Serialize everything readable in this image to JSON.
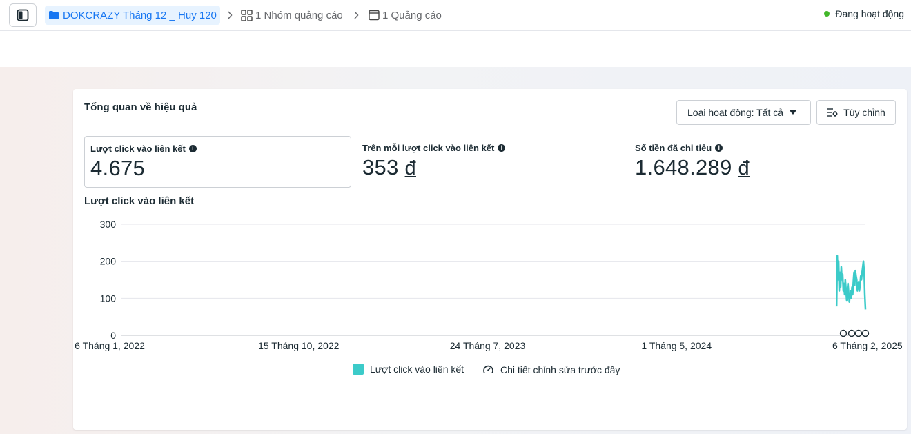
{
  "topbar": {
    "campaign_name": "DOKCRAZY Tháng 12 _ Huy 120",
    "adsets_label": "1 Nhóm quảng cáo",
    "ads_label": "1 Quảng cáo",
    "status_label": "Đang hoạt động",
    "status_color": "#42b72a"
  },
  "card": {
    "title": "Tổng quan về hiệu quả",
    "filter_button": "Loại hoạt động: Tất cả",
    "customize_button": "Tùy chỉnh"
  },
  "metrics": [
    {
      "label": "Lượt click vào liên kết",
      "value": "4.675",
      "currency": ""
    },
    {
      "label": "Trên mỗi lượt click vào liên kết",
      "value": "353",
      "currency": "đ"
    },
    {
      "label": "Số tiền đã chi tiêu",
      "value": "1.648.289",
      "currency": "đ"
    }
  ],
  "chart_data": {
    "type": "line",
    "title": "Lượt click vào liên kết",
    "xlabel": "",
    "ylabel": "",
    "x_tick_labels": [
      "6 Tháng 1, 2022",
      "15 Tháng 10, 2022",
      "24 Tháng 7, 2023",
      "1 Tháng 5, 2024",
      "6 Tháng 2, 2025"
    ],
    "y_ticks": [
      0,
      100,
      200,
      300
    ],
    "ylim": [
      0,
      300
    ],
    "xlim": [
      "2022-01-06",
      "2025-02-06"
    ],
    "grid": true,
    "legend_position": "bottom",
    "series": [
      {
        "name": "Lượt click vào liên kết",
        "color": "#3ccbc9",
        "x": [
          "2024-12-25",
          "2024-12-26",
          "2024-12-27",
          "2024-12-28",
          "2024-12-29",
          "2024-12-30",
          "2024-12-31",
          "2025-01-01",
          "2025-01-02",
          "2025-01-03",
          "2025-01-04",
          "2025-01-05",
          "2025-01-06",
          "2025-01-07",
          "2025-01-08",
          "2025-01-09",
          "2025-01-10",
          "2025-01-11",
          "2025-01-12",
          "2025-01-13",
          "2025-01-14",
          "2025-01-15",
          "2025-01-16",
          "2025-01-17",
          "2025-01-18",
          "2025-01-19",
          "2025-01-20",
          "2025-01-21",
          "2025-01-22",
          "2025-01-23",
          "2025-01-24",
          "2025-01-25",
          "2025-01-26",
          "2025-01-27",
          "2025-01-28",
          "2025-01-29",
          "2025-01-30",
          "2025-01-31",
          "2025-02-01",
          "2025-02-02",
          "2025-02-03",
          "2025-02-04",
          "2025-02-05",
          "2025-02-06"
        ],
        "values": [
          78,
          215,
          150,
          200,
          120,
          170,
          130,
          185,
          150,
          165,
          120,
          140,
          110,
          150,
          125,
          95,
          120,
          140,
          115,
          90,
          110,
          120,
          100,
          130,
          110,
          145,
          170,
          135,
          175,
          160,
          150,
          120,
          140,
          145,
          120,
          135,
          160,
          150,
          170,
          185,
          200,
          175,
          110,
          70
        ]
      }
    ],
    "annotations_label": "Chi tiết chỉnh sửa trước đây"
  }
}
